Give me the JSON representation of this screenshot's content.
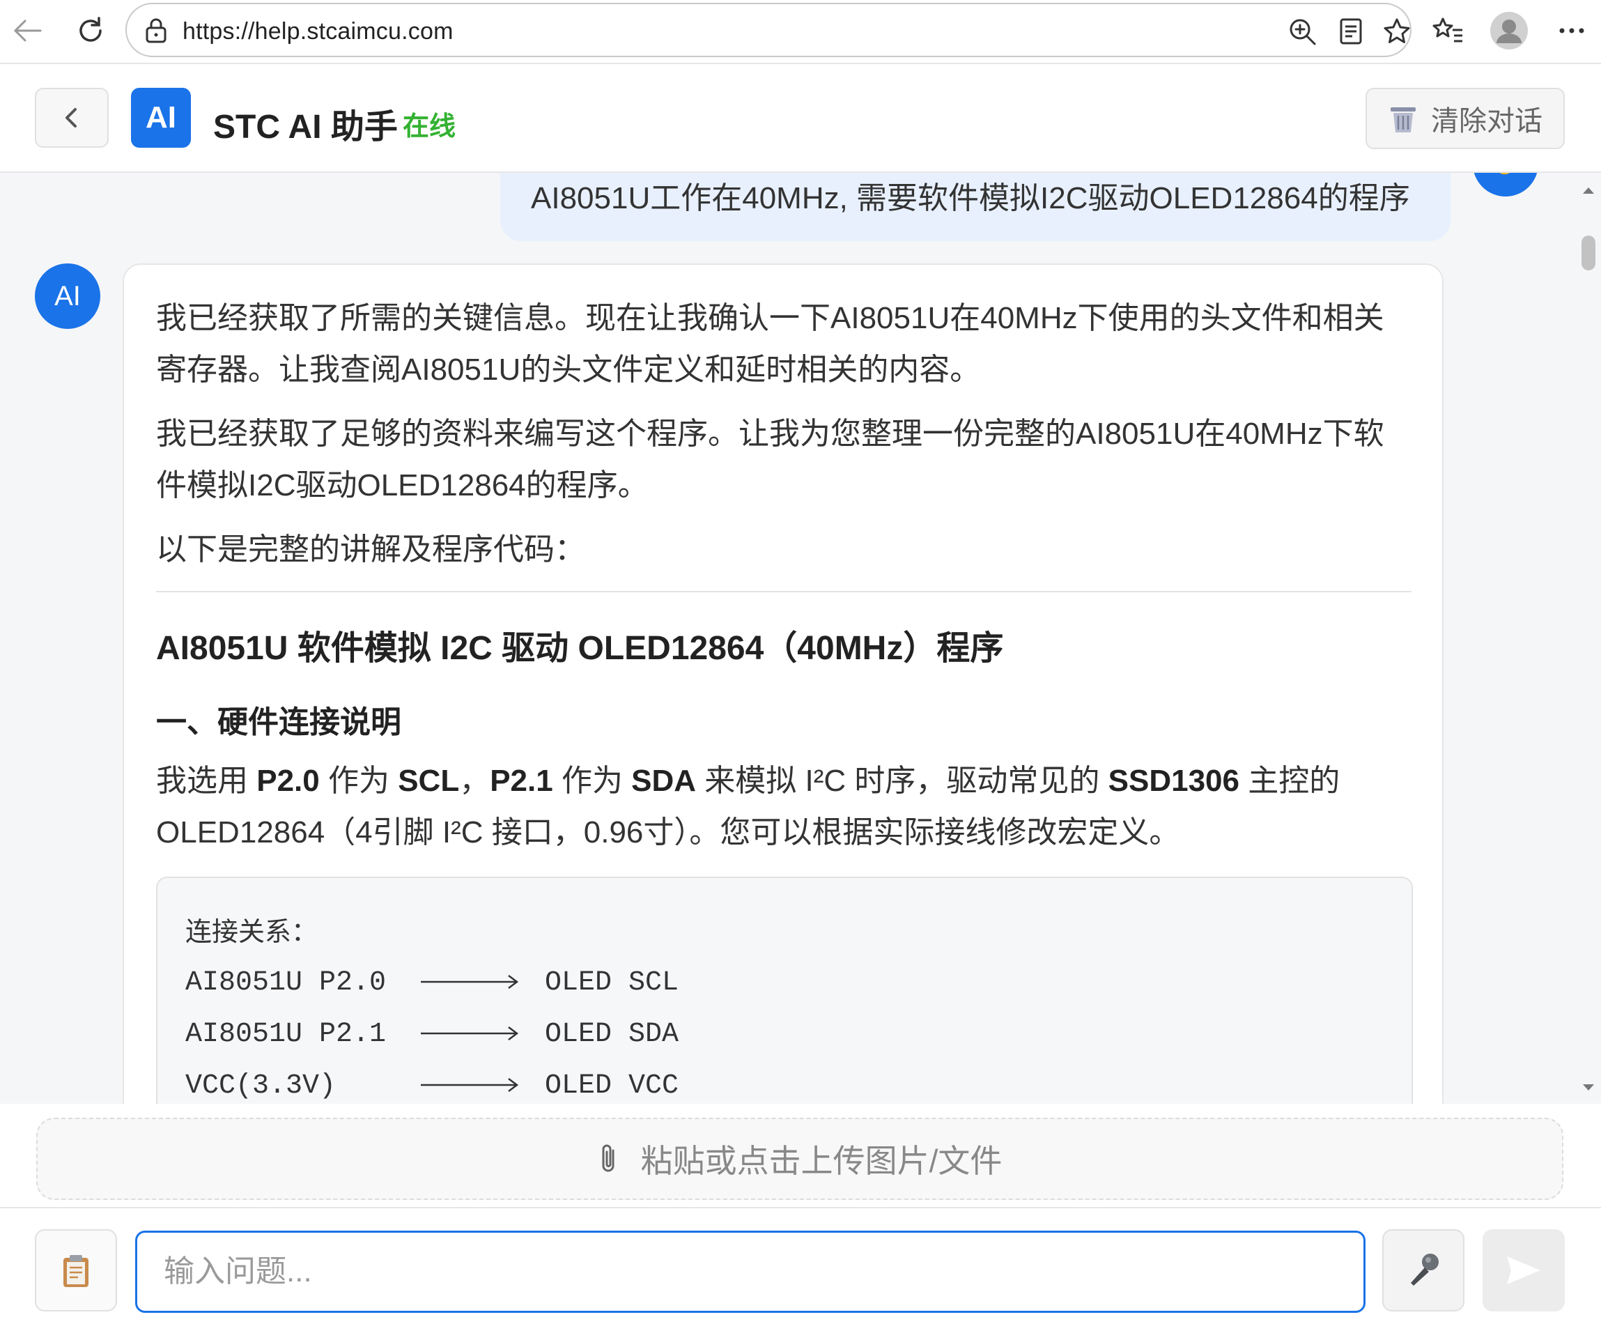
{
  "browser": {
    "url": "https://help.stcaimcu.com"
  },
  "header": {
    "logo_text": "AI",
    "title": "STC AI 助手",
    "status": "在线",
    "clear_label": "清除对话"
  },
  "chat": {
    "user_message": "AI8051U工作在40MHz, 需要软件模拟I2C驱动OLED12864的程序",
    "ai_avatar": "AI",
    "para1": "我已经获取了所需的关键信息。现在让我确认一下AI8051U在40MHz下使用的头文件和相关寄存器。让我查阅AI8051U的头文件定义和延时相关的内容。",
    "para2": "我已经获取了足够的资料来编写这个程序。让我为您整理一份完整的AI8051U在40MHz下软件模拟I2C驱动OLED12864的程序。",
    "para3": "以下是完整的讲解及程序代码：",
    "heading": "AI8051U 软件模拟 I2C 驱动 OLED12864（40MHz）程序",
    "section1": "一、硬件连接说明",
    "hw": {
      "t1": "我选用 ",
      "scl_pin": "P2.0",
      "t2": " 作为 ",
      "scl": "SCL",
      "t3": "，",
      "sda_pin": "P2.1",
      "t4": " 作为 ",
      "sda": "SDA",
      "t5": " 来模拟 I²C 时序，驱动常见的 ",
      "chip": "SSD1306",
      "t6": " 主控的 OLED12864（4引脚 I²C 接口，0.96寸）。您可以根据实际接线修改宏定义。"
    },
    "code": {
      "comment": "连接关系：",
      "rows": [
        {
          "left": "AI8051U P2.0",
          "right": "OLED SCL"
        },
        {
          "left": "AI8051U P2.1",
          "right": "OLED SDA"
        },
        {
          "left": "VCC(3.3V)",
          "right": "OLED VCC"
        }
      ]
    }
  },
  "upload": {
    "label": "粘贴或点击上传图片/文件"
  },
  "input": {
    "placeholder": "输入问题..."
  },
  "colors": {
    "accent": "#1a73e8",
    "online": "#34b233",
    "user_bubble": "#e8f0fe"
  }
}
